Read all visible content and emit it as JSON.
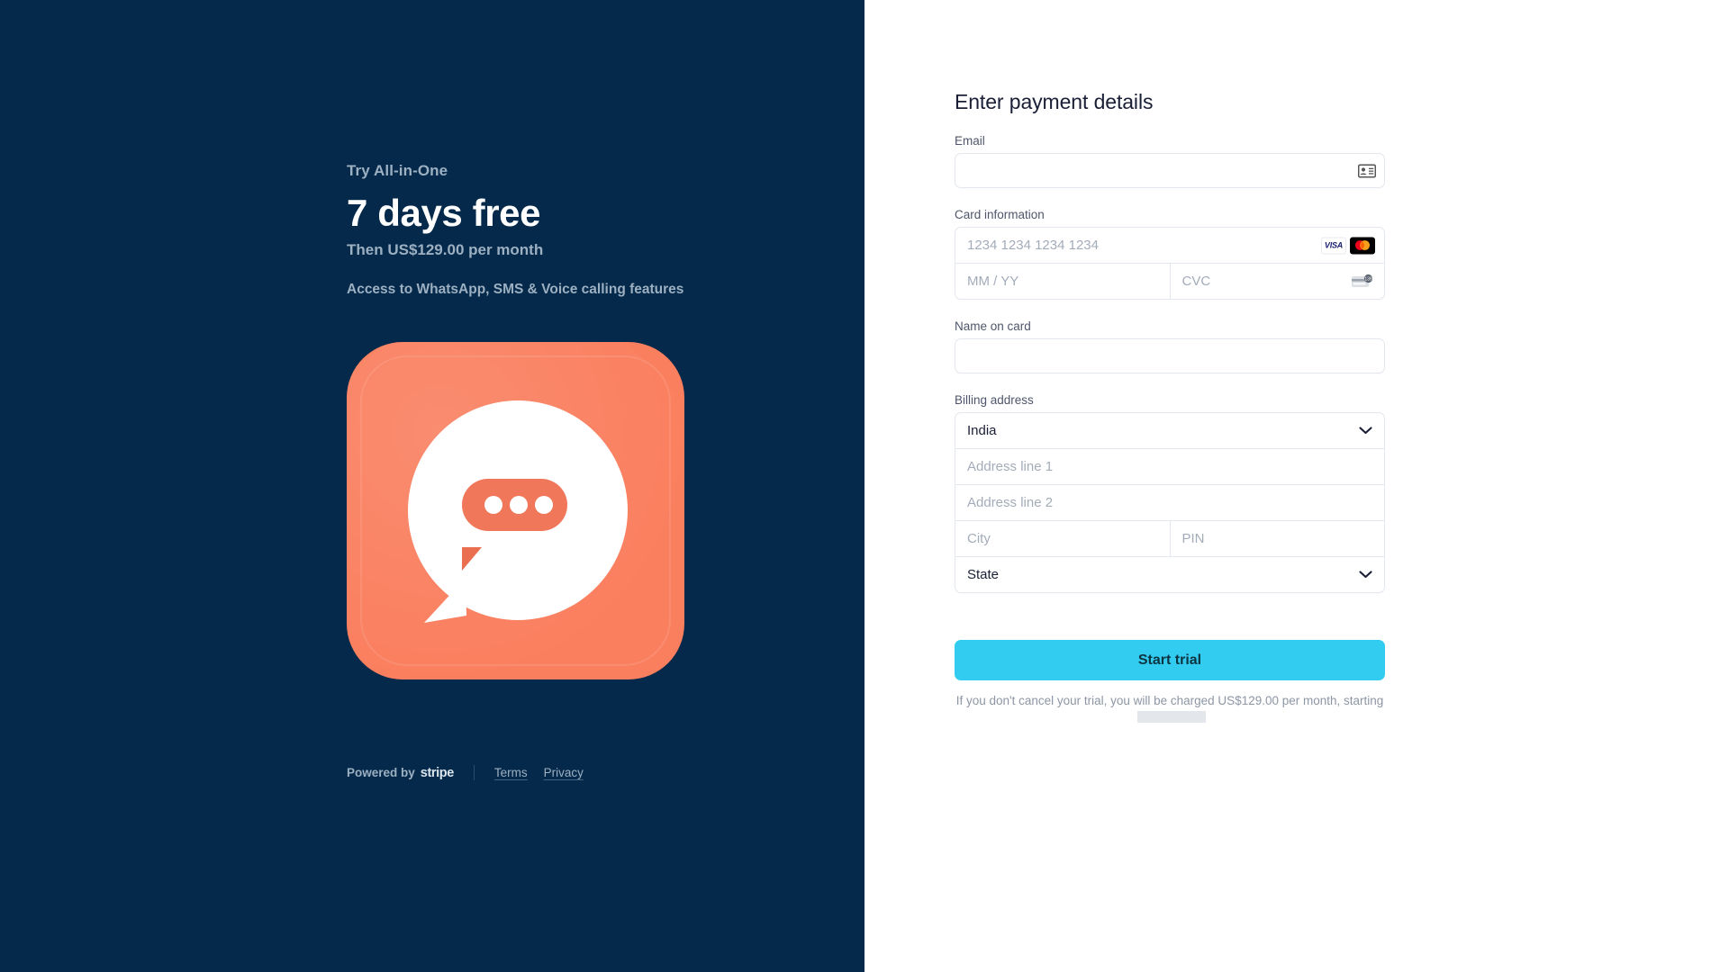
{
  "left": {
    "eyebrow": "Try All-in-One",
    "headline": "7 days free",
    "subline": "Then US$129.00 per month",
    "features": "Access to WhatsApp, SMS & Voice calling features",
    "app_icon_name": "chat-bubble-app-icon",
    "footer": {
      "powered_by": "Powered by",
      "stripe": "stripe",
      "terms": "Terms",
      "privacy": "Privacy"
    }
  },
  "form": {
    "title": "Enter payment details",
    "email": {
      "label": "Email",
      "value": "",
      "placeholder": "",
      "autofill_icon": "contact-card-icon"
    },
    "card": {
      "label": "Card information",
      "number_placeholder": "1234 1234 1234 1234",
      "number_value": "",
      "expiry_placeholder": "MM / YY",
      "expiry_value": "",
      "cvc_placeholder": "CVC",
      "cvc_value": "",
      "brands": [
        "VISA",
        "mastercard"
      ],
      "visa_label": "VISA",
      "cvc_icon": "cvc-card-icon"
    },
    "name_on_card": {
      "label": "Name on card",
      "value": "",
      "placeholder": ""
    },
    "billing": {
      "label": "Billing address",
      "country_value": "India",
      "address1_placeholder": "Address line 1",
      "address1_value": "",
      "address2_placeholder": "Address line 2",
      "address2_value": "",
      "city_placeholder": "City",
      "city_value": "",
      "pin_placeholder": "PIN",
      "pin_value": "",
      "state_placeholder": "State",
      "state_value": ""
    },
    "submit_label": "Start trial",
    "disclaimer_prefix": "If you don't cancel your trial, you will be charged US$129.00 per month, starting"
  },
  "colors": {
    "left_bg": "#05294a",
    "accent_icon": "#fa7f5f",
    "button": "#31ccf0",
    "muted_text": "#9cb0c2",
    "border": "#e3e8ee"
  }
}
